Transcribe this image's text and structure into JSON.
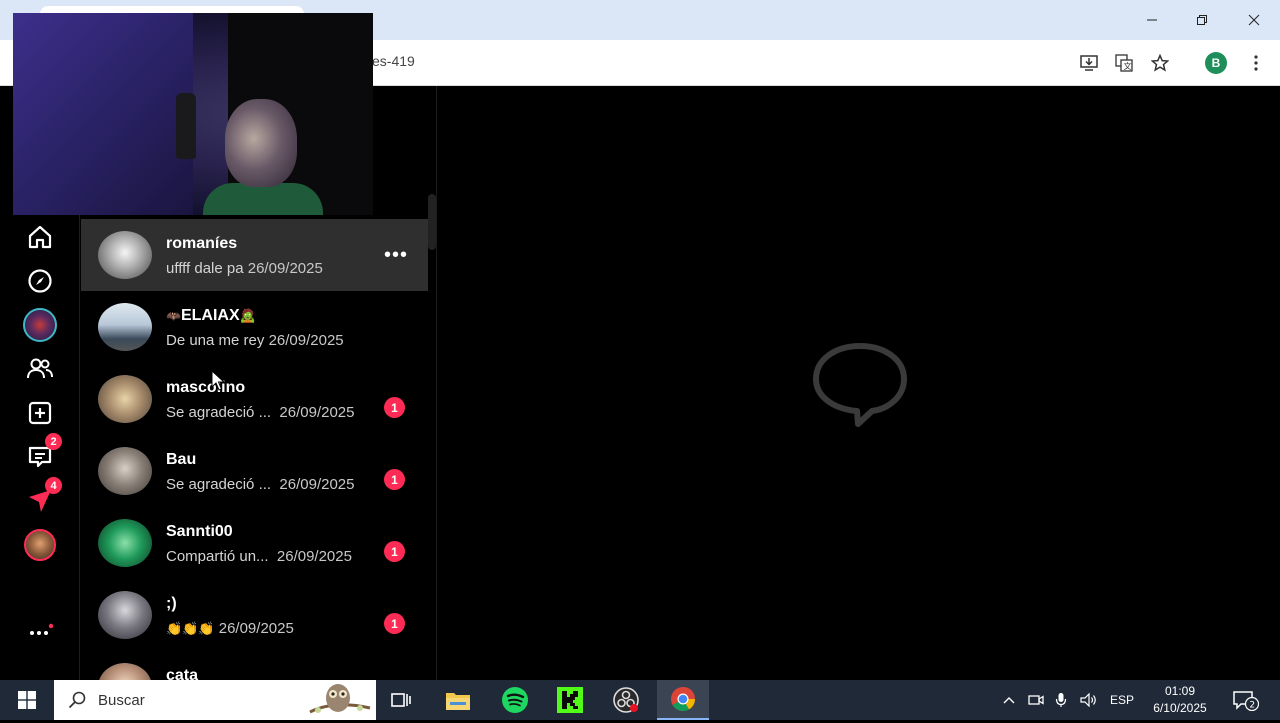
{
  "browser": {
    "url_fragment": "es-419",
    "profile_initial": "B"
  },
  "rail": {
    "messages_badge": "2",
    "activity_badge": "4"
  },
  "conversations": [
    {
      "name": "romaníes",
      "preview": "uffff dale pa",
      "date": "26/09/2025",
      "unread": "",
      "active": true
    },
    {
      "name": "ELAIAX",
      "prefix_emoji": "🦇",
      "suffix_emoji": "🧟",
      "preview": "De una me rey",
      "date": "26/09/2025",
      "unread": ""
    },
    {
      "name": "mascolino",
      "preview": "Se agradeció ...",
      "date": "26/09/2025",
      "unread": "1"
    },
    {
      "name": "Bau",
      "preview": "Se agradeció ...",
      "date": "26/09/2025",
      "unread": "1"
    },
    {
      "name": "Sannti00",
      "preview": "Compartió un...",
      "date": "26/09/2025",
      "unread": "1"
    },
    {
      "name": ";)",
      "preview": "👏👏👏",
      "date": "26/09/2025",
      "unread": "1"
    },
    {
      "name": "cata",
      "preview": "",
      "date": "",
      "unread": ""
    }
  ],
  "taskbar": {
    "search_placeholder": "Buscar",
    "language": "ESP",
    "time": "01:09",
    "date": "6/10/2025",
    "notification_count": "2"
  },
  "colors": {
    "accent": "#fe2c55",
    "active_row": "#2f2f2f",
    "taskbar": "#1f2937"
  }
}
